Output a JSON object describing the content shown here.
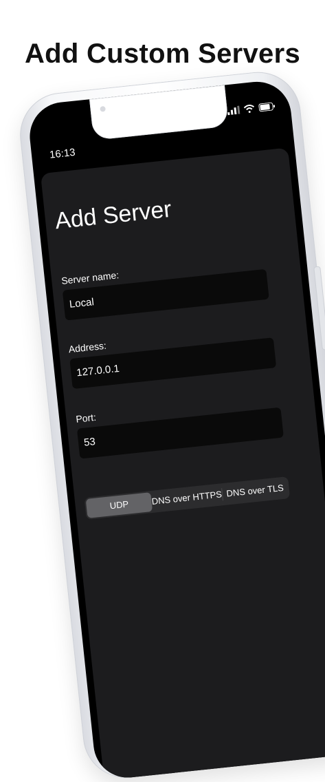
{
  "headline": "Add Custom Servers",
  "status_bar": {
    "time": "16:13"
  },
  "sheet": {
    "title": "Add Server",
    "fields": [
      {
        "label": "Server name:",
        "value": "Local"
      },
      {
        "label": "Address:",
        "value": "127.0.0.1"
      },
      {
        "label": "Port:",
        "value": "53"
      }
    ],
    "protocol_options": [
      "UDP",
      "DNS over HTTPS",
      "DNS over TLS"
    ],
    "selected_protocol": "UDP"
  },
  "colors": {
    "sheet_background": "#1c1c1e",
    "field_background": "#0a0a0a",
    "segment_selected": "#636366"
  },
  "icons": [
    "cellular-signal-icon",
    "wifi-icon",
    "battery-icon"
  ]
}
